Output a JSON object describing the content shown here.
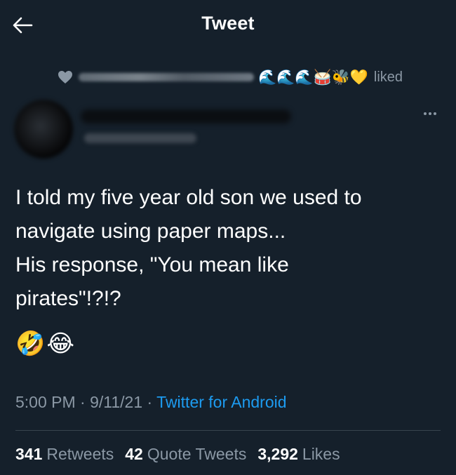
{
  "header": {
    "title": "Tweet",
    "back_icon": "arrow-left-icon"
  },
  "social_context": {
    "icon": "heart-icon",
    "emoji_sequence": "🌊🌊🌊🥁🐝💛",
    "liked_label": "liked"
  },
  "author": {
    "more_icon": "more-horizontal-icon"
  },
  "tweet": {
    "text": "I told my five year old son we used to\nnavigate using paper maps...\nHis response, \"You mean like\npirates\"!?!?",
    "emojis": "🤣😂"
  },
  "meta": {
    "time": "5:00 PM",
    "separator": " · ",
    "date": "9/11/21",
    "source": "Twitter for Android"
  },
  "stats": {
    "retweets_count": "341",
    "retweets_label": "Retweets",
    "quotes_count": "42",
    "quotes_label": "Quote Tweets",
    "likes_count": "3,292",
    "likes_label": "Likes"
  },
  "colors": {
    "background": "#15202b",
    "text": "#ffffff",
    "muted": "#8b98a5",
    "accent": "#1d9bf0",
    "divider": "#38444d"
  }
}
